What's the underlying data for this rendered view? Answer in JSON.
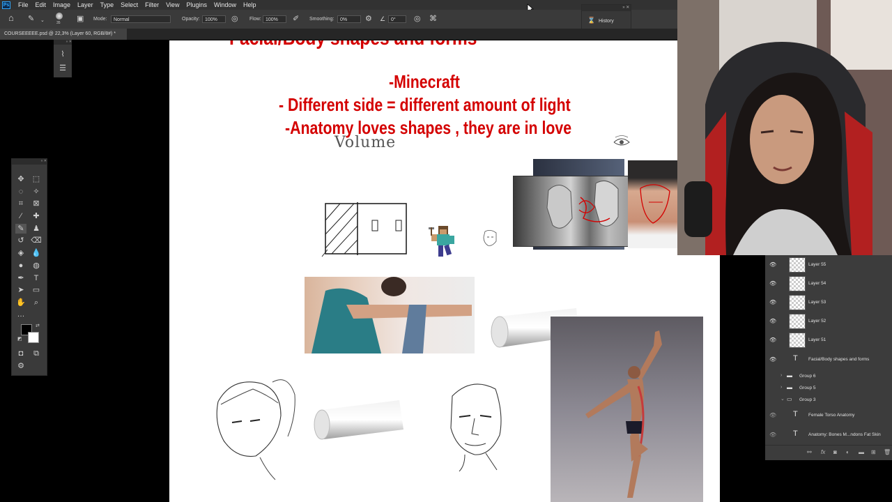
{
  "menu": {
    "logo": "Ps",
    "items": [
      "File",
      "Edit",
      "Image",
      "Layer",
      "Type",
      "Select",
      "Filter",
      "View",
      "Plugins",
      "Window",
      "Help"
    ]
  },
  "options": {
    "brush_size": "35",
    "mode_label": "Mode:",
    "mode_value": "Normal",
    "opacity_label": "Opacity:",
    "opacity_value": "100%",
    "flow_label": "Flow:",
    "flow_value": "100%",
    "smoothing_label": "Smoothing:",
    "smoothing_value": "0%",
    "angle_value": "0°"
  },
  "history_panel": {
    "label": "History"
  },
  "document_tab": {
    "title": "COURSEEEEE.psd @ 22,3% (Layer 60, RGB/8#) *"
  },
  "canvas": {
    "title_fragment": "Facial/Body shapes and forms",
    "bullet_1": "-Minecraft",
    "bullet_2": "- Different side = different amount of light",
    "bullet_3": "-Anatomy loves shapes , they are in love",
    "handwritten": "Volume"
  },
  "layers": [
    {
      "name": "Layer 55",
      "visible": true,
      "kind": "pixel"
    },
    {
      "name": "Layer 54",
      "visible": true,
      "kind": "pixel"
    },
    {
      "name": "Layer 53",
      "visible": true,
      "kind": "pixel"
    },
    {
      "name": "Layer 52",
      "visible": true,
      "kind": "pixel"
    },
    {
      "name": "Layer 51",
      "visible": true,
      "kind": "pixel"
    },
    {
      "name": "Facial/Body shapes and forms",
      "visible": true,
      "kind": "text"
    },
    {
      "name": "Group 6",
      "visible": false,
      "kind": "group"
    },
    {
      "name": "Group 5",
      "visible": false,
      "kind": "group"
    },
    {
      "name": "Group 3",
      "visible": false,
      "kind": "group-open"
    },
    {
      "name": "Female Torso Anatomy",
      "visible": true,
      "kind": "text"
    },
    {
      "name": "Anatomy: Bones M...ndons Fat Skin",
      "visible": true,
      "kind": "text"
    }
  ],
  "colors": {
    "accent_red": "#d40000",
    "ps_blue": "#31a8ff",
    "panel_bg": "#3a3a3a"
  }
}
